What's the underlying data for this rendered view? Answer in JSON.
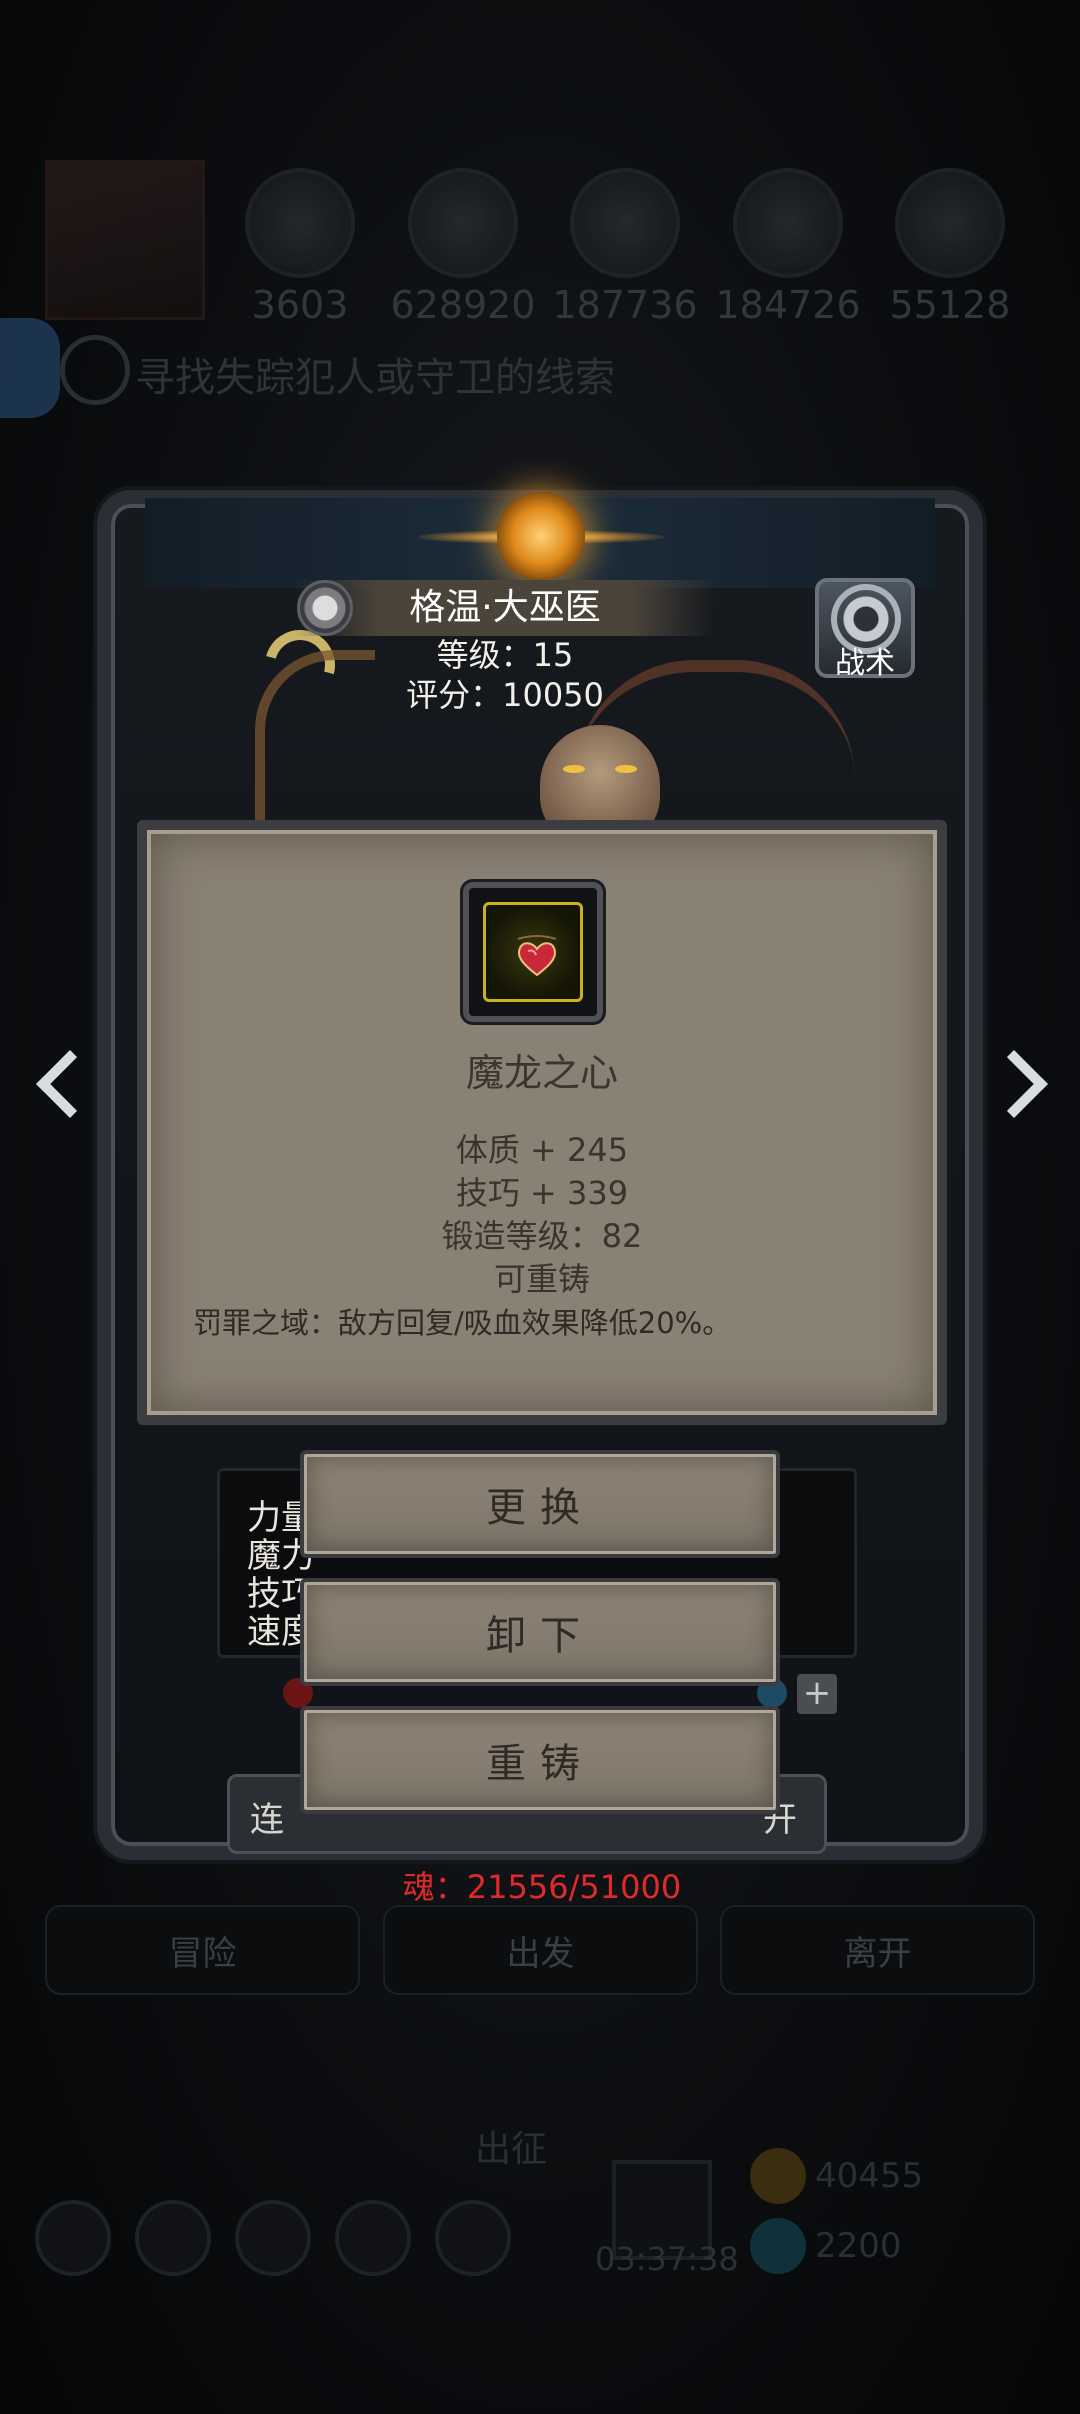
{
  "background": {
    "resources": [
      "3603",
      "628920",
      "187736",
      "184726",
      "55128"
    ],
    "quest_text": "寻找失踪犯人或守卫的线索",
    "bottom_tabs": [
      "冒险",
      "出发",
      "离开"
    ],
    "march_label": "出征",
    "timer": "03:37:38",
    "gold": "40455",
    "gems": "2200"
  },
  "hero": {
    "name": "格温·大巫医",
    "level": "等级：15",
    "score": "评分：10050",
    "tactics_label": "战术"
  },
  "item": {
    "name": "魔龙之心",
    "stats": [
      "体质 + 245",
      "技巧 + 339",
      "锻造等级：82",
      "可重铸"
    ],
    "effect": "罚罪之域：敌方回复/吸血效果降低20%。",
    "icon": "dragon-heart-necklace-icon",
    "rarity_color": "#c9b21c"
  },
  "hero_stats_partial": [
    "力量",
    "魔力",
    "技巧",
    "速度"
  ],
  "continue_label_partial": "连",
  "continue_end_partial": "开",
  "actions": {
    "replace": "更换",
    "unequip": "卸下",
    "reforge": "重铸"
  },
  "soul": "魂：21556/51000",
  "colors": {
    "soul_text": "#e02a2a",
    "parchment": "#8a8175",
    "gem_glow": "#e08a1a"
  }
}
